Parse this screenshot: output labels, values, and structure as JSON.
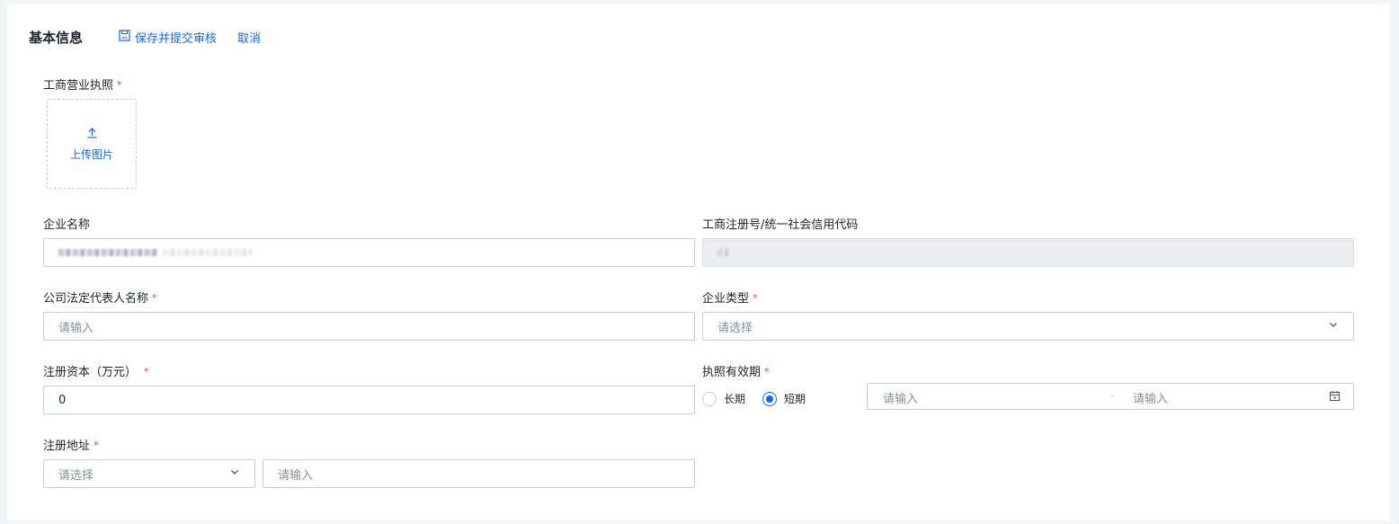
{
  "header": {
    "title": "基本信息",
    "save_label": "保存并提交审核",
    "cancel_label": "取消"
  },
  "required_mark": "*",
  "license": {
    "label": "工商营业执照",
    "upload_label": "上传图片"
  },
  "company_name": {
    "label": "企业名称"
  },
  "credit_code": {
    "label": "工商注册号/统一社会信用代码"
  },
  "legal_rep": {
    "label": "公司法定代表人名称",
    "placeholder": "请输入"
  },
  "company_type": {
    "label": "企业类型",
    "placeholder": "请选择"
  },
  "capital": {
    "label": "注册资本（万元）",
    "value": "0"
  },
  "validity": {
    "label": "执照有效期",
    "options": [
      "长期",
      "短期"
    ],
    "selected": "短期",
    "start_placeholder": "请输入",
    "end_placeholder": "请输入",
    "separator": "-"
  },
  "address": {
    "label": "注册地址",
    "region_placeholder": "请选择",
    "detail_placeholder": "请输入"
  },
  "colors": {
    "accent": "#1664ff",
    "required": "#f53f3f",
    "border": "#c9cdd4",
    "disabled_bg": "#ebedf0"
  }
}
